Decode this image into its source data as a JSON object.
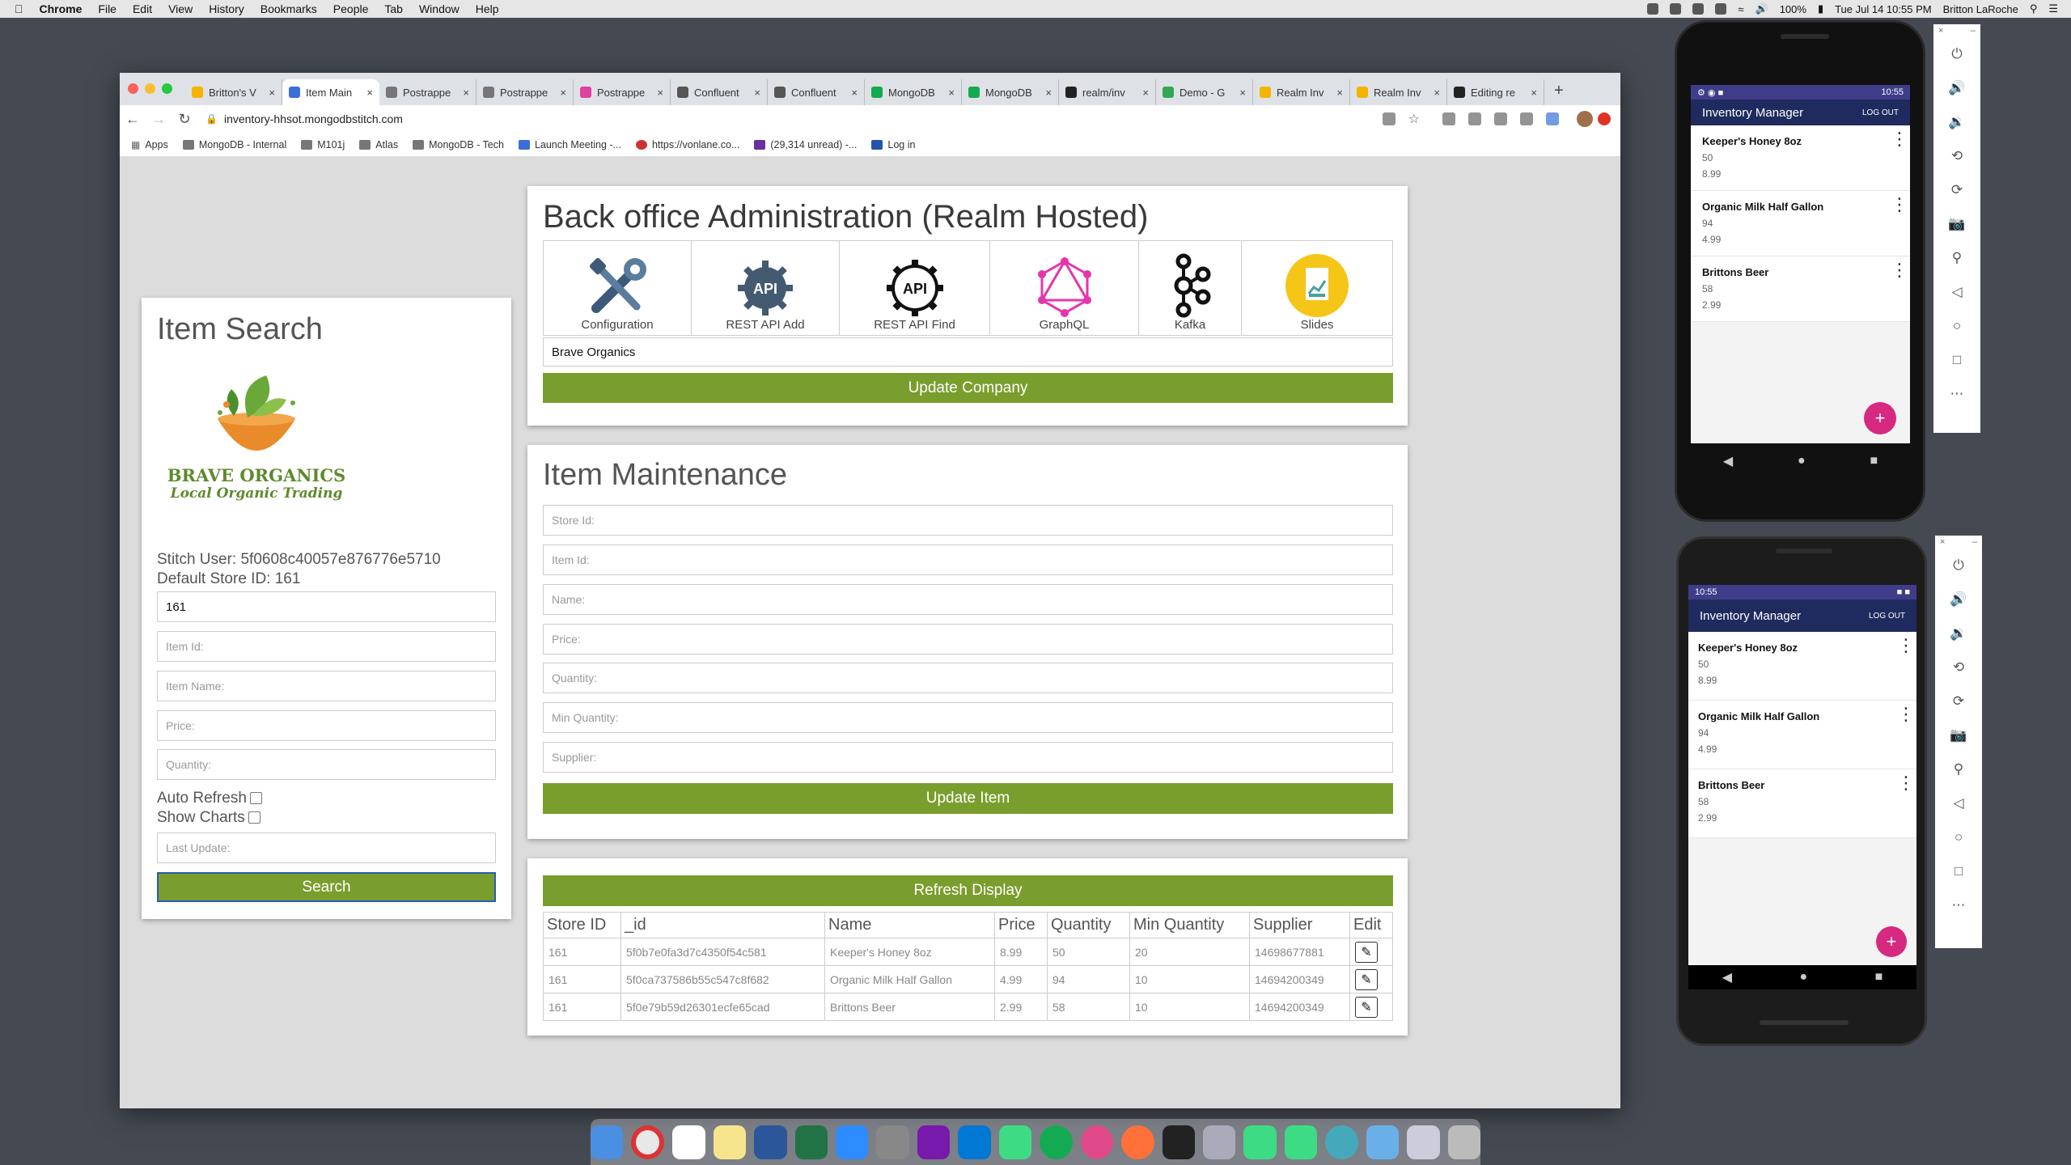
{
  "menubar": {
    "app": "Chrome",
    "items": [
      "File",
      "Edit",
      "View",
      "History",
      "Bookmarks",
      "People",
      "Tab",
      "Window",
      "Help"
    ],
    "battery": "100%",
    "clock": "Tue Jul 14  10:55 PM",
    "user": "Britton LaRoche"
  },
  "browser": {
    "tabs": [
      {
        "label": "Britton's V",
        "color": "#f4b400"
      },
      {
        "label": "Item Main",
        "color": "#3a6fd8",
        "active": true
      },
      {
        "label": "Postrappe",
        "color": "#777"
      },
      {
        "label": "Postrappe",
        "color": "#777"
      },
      {
        "label": "Postrappe",
        "color": "#e040a0"
      },
      {
        "label": "Confluent",
        "color": "#555"
      },
      {
        "label": "Confluent",
        "color": "#555"
      },
      {
        "label": "MongoDB",
        "color": "#13aa52"
      },
      {
        "label": "MongoDB",
        "color": "#13aa52"
      },
      {
        "label": "realm/inv",
        "color": "#222"
      },
      {
        "label": "Demo - G",
        "color": "#34a853"
      },
      {
        "label": "Realm Inv",
        "color": "#f4b400"
      },
      {
        "label": "Realm Inv",
        "color": "#f4b400"
      },
      {
        "label": "Editing re",
        "color": "#222"
      }
    ],
    "url": "inventory-hhsot.mongodbstitch.com",
    "bookmarks": [
      "Apps",
      "MongoDB - Internal",
      "M101j",
      "Atlas",
      "MongoDB  - Tech",
      "Launch Meeting -...",
      "https://vonlane.co...",
      "(29,314 unread) -...",
      "Log in"
    ]
  },
  "item_search": {
    "title": "Item Search",
    "logo_line1": "BRAVE ORGANICS",
    "logo_line2": "Local Organic Trading",
    "stitch_user": "Stitch User: 5f0608c40057e876776e5710",
    "default_store": "Default Store ID: 161",
    "store_value": "161",
    "placeholders": {
      "item_id": "Item Id:",
      "item_name": "Item Name:",
      "price": "Price:",
      "quantity": "Quantity:",
      "last_update": "Last Update:"
    },
    "auto_refresh": "Auto Refresh",
    "show_charts": "Show Charts",
    "search_button": "Search"
  },
  "admin": {
    "title": "Back office Administration (Realm Hosted)",
    "tiles": [
      {
        "label": "Configuration",
        "icon": "tools-icon"
      },
      {
        "label": "REST API Add",
        "icon": "api-gear-icon"
      },
      {
        "label": "REST API Find",
        "icon": "api-gear-outline-icon"
      },
      {
        "label": "GraphQL",
        "icon": "graphql-icon"
      },
      {
        "label": "Kafka",
        "icon": "kafka-icon"
      },
      {
        "label": "Slides",
        "icon": "slides-icon"
      }
    ],
    "company": "Brave Organics",
    "update_button": "Update Company"
  },
  "maintenance": {
    "title": "Item Maintenance",
    "placeholders": {
      "store_id": "Store Id:",
      "item_id": "Item Id:",
      "name": "Name:",
      "price": "Price:",
      "quantity": "Quantity:",
      "min_quantity": "Min Quantity:",
      "supplier": "Supplier:"
    },
    "update_button": "Update Item"
  },
  "table": {
    "refresh_button": "Refresh Display",
    "headers": [
      "Store ID",
      "_id",
      "Name",
      "Price",
      "Quantity",
      "Min Quantity",
      "Supplier",
      "Edit"
    ],
    "rows": [
      [
        "161",
        "5f0b7e0fa3d7c4350f54c581",
        "Keeper's Honey 8oz",
        "8.99",
        "50",
        "20",
        "14698677881"
      ],
      [
        "161",
        "5f0ca737586b55c547c8f682",
        "Organic Milk Half Gallon",
        "4.99",
        "94",
        "10",
        "14694200349"
      ],
      [
        "161",
        "5f0e79b59d26301ecfe65cad",
        "Brittons Beer",
        "2.99",
        "58",
        "10",
        "14694200349"
      ]
    ]
  },
  "phone": {
    "time": "10:55",
    "app_title": "Inventory Manager",
    "logout": "LOG OUT",
    "items": [
      {
        "name": "Keeper's Honey 8oz",
        "qty": "50",
        "price": "8.99"
      },
      {
        "name": "Organic Milk Half Gallon",
        "qty": "94",
        "price": "4.99"
      },
      {
        "name": "Brittons Beer",
        "qty": "58",
        "price": "2.99"
      }
    ],
    "fab": "+"
  },
  "emulator_controls": [
    "power-icon",
    "volume-up-icon",
    "volume-down-icon",
    "rotate-left-icon",
    "rotate-right-icon",
    "camera-icon",
    "zoom-icon",
    "back-icon",
    "home-icon",
    "overview-icon",
    "more-icon"
  ],
  "colors": {
    "accent_green": "#7a9e2d",
    "phone_appbar": "#1f2b5e",
    "fab": "#d6297f"
  }
}
